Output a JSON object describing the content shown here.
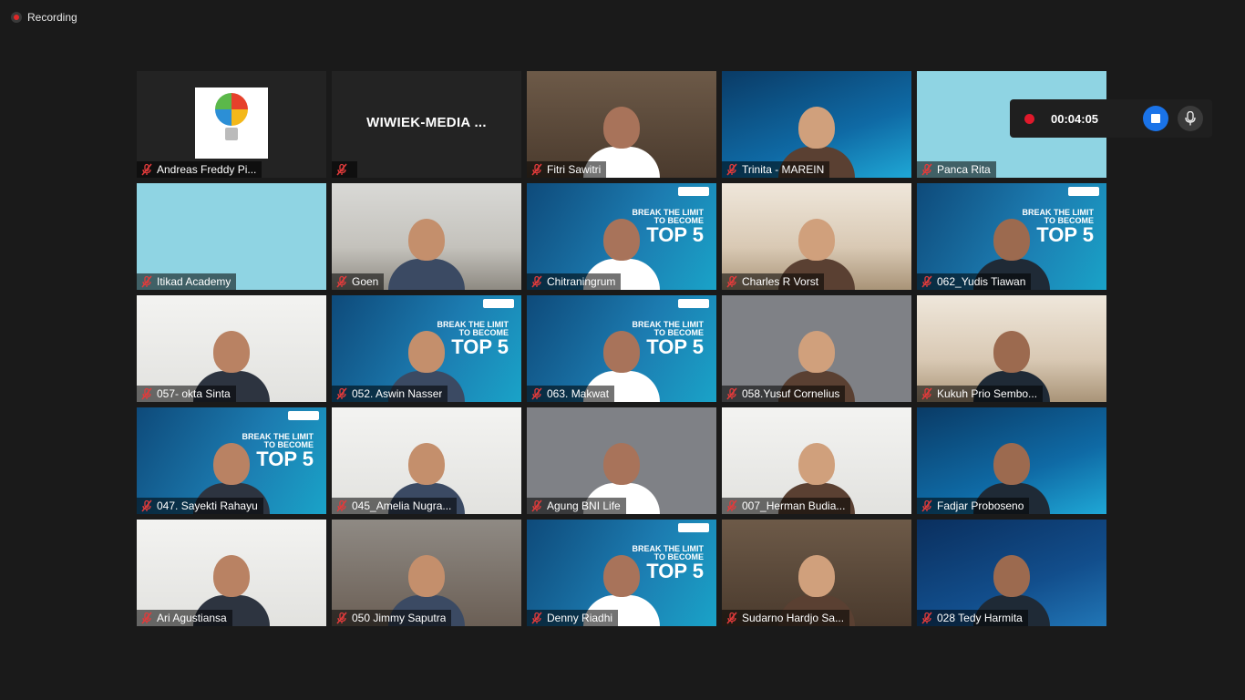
{
  "recording": {
    "label": "Recording"
  },
  "recording_control": {
    "timer": "00:04:05"
  },
  "participants": [
    {
      "name": "Andreas Freddy Pi...",
      "scene": "logo"
    },
    {
      "name": "",
      "center_label": "WIWIEK-MEDIA ...",
      "scene": "blank"
    },
    {
      "name": "Fitri Sawitri",
      "scene": "books"
    },
    {
      "name": "Trinita - MAREIN",
      "scene": "tech"
    },
    {
      "name": "Panca Rita",
      "scene": "slide"
    },
    {
      "name": "Itikad Academy",
      "scene": "slide"
    },
    {
      "name": "Goen",
      "scene": "room",
      "active": true
    },
    {
      "name": "Chitraningrum",
      "scene": "bni"
    },
    {
      "name": "Charles R Vorst",
      "scene": "warm"
    },
    {
      "name": "062_Yudis Tiawan",
      "scene": "bni"
    },
    {
      "name": "057- okta Sinta",
      "scene": "white"
    },
    {
      "name": "052. Aswin Nasser",
      "scene": "bni"
    },
    {
      "name": "063. Makwat",
      "scene": "bni"
    },
    {
      "name": "058.Yusuf Cornelius",
      "scene": "grey"
    },
    {
      "name": "Kukuh Prio Sembo...",
      "scene": "warm"
    },
    {
      "name": "047. Sayekti Rahayu",
      "scene": "bni"
    },
    {
      "name": "045_Amelia Nugra...",
      "scene": "white"
    },
    {
      "name": "Agung BNI Life",
      "scene": "grey"
    },
    {
      "name": "007_Herman Budia...",
      "scene": "white"
    },
    {
      "name": "Fadjar Proboseno",
      "scene": "tech"
    },
    {
      "name": "Ari Agustiansa",
      "scene": "white"
    },
    {
      "name": "050 Jimmy Saputra",
      "scene": "office"
    },
    {
      "name": "Denny Riadhi",
      "scene": "bni"
    },
    {
      "name": "Sudarno Hardjo Sa...",
      "scene": "books"
    },
    {
      "name": "028 Tedy Harmita",
      "scene": "bca"
    }
  ],
  "bni_banner": {
    "line1": "BREAK THE LIMIT",
    "line2": "TO BECOME",
    "line3": "TOP 5"
  },
  "colors": {
    "background": "#1a1a1a",
    "active_speaker_border": "#c8dc5a",
    "record_red": "#e0192b",
    "stop_blue": "#1a73e8"
  }
}
